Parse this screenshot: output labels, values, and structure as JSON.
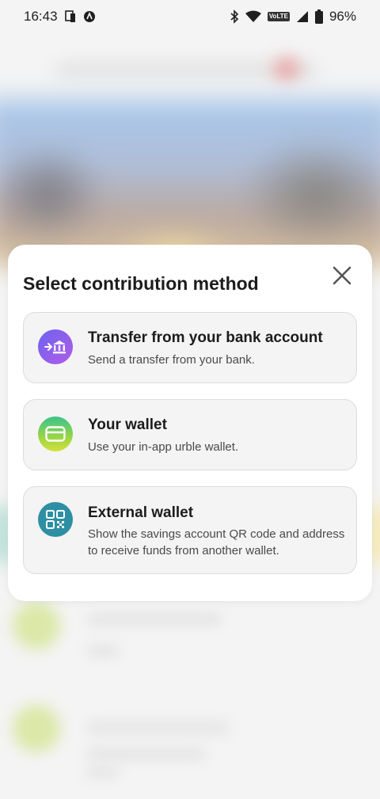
{
  "status_bar": {
    "time": "16:43",
    "battery_percent": "96%",
    "volte_label": "VoLTE",
    "left_icons": [
      "screen-cast-icon",
      "vpn-icon"
    ],
    "right_icons": [
      "bluetooth-icon",
      "wifi-icon",
      "volte-icon",
      "signal-icon",
      "battery-icon"
    ]
  },
  "modal": {
    "title": "Select contribution method",
    "close_icon": "close-icon",
    "options": [
      {
        "title": "Transfer from your bank account",
        "description": "Send a transfer from your bank.",
        "icon": "bank-transfer-icon",
        "icon_gradient": [
          "#6c63f0",
          "#b25be8"
        ]
      },
      {
        "title": "Your wallet",
        "description": "Use your in-app urble wallet.",
        "icon": "wallet-icon",
        "icon_gradient": [
          "#39c38c",
          "#d4e03a"
        ]
      },
      {
        "title": "External wallet",
        "description": "Show the savings account QR code and address to receive funds from another wallet.",
        "icon": "qr-code-icon",
        "icon_color": "#2d8fa3"
      }
    ]
  },
  "colors": {
    "modal_background": "#ffffff",
    "option_background": "#f4f4f4",
    "option_border": "#dcdcdc",
    "text_primary": "#1c1c1c",
    "text_secondary": "#4a4a4a"
  }
}
